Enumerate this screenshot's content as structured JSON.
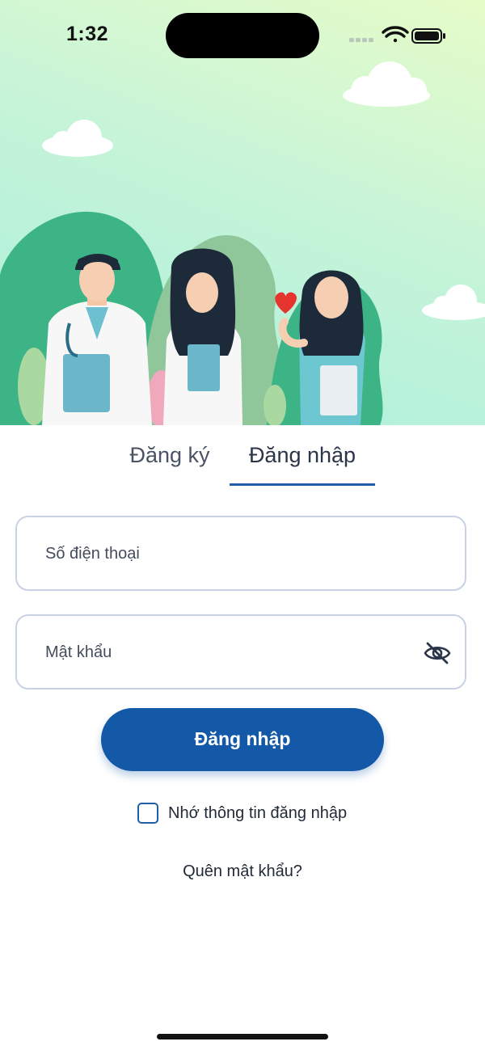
{
  "status_bar": {
    "time": "1:32"
  },
  "tabs": [
    {
      "label": "Đăng ký",
      "active": false
    },
    {
      "label": "Đăng nhập",
      "active": true
    }
  ],
  "form": {
    "phone_placeholder": "Số điện thoại",
    "phone_value": "",
    "password_placeholder": "Mật khẩu",
    "password_value": "",
    "password_toggle_icon": "eye-slash-icon",
    "login_button": "Đăng nhập",
    "remember_label": "Nhớ thông tin đăng nhập",
    "remember_checked": false,
    "forgot_password": "Quên mật khẩu?"
  },
  "colors": {
    "primary": "#1459a8",
    "tab_underline": "#1f5fa8",
    "field_border": "#c8d2e4",
    "hero_green": "#3db486"
  },
  "illustration": {
    "subject": "three medical staff illustration with heart and clouds"
  }
}
